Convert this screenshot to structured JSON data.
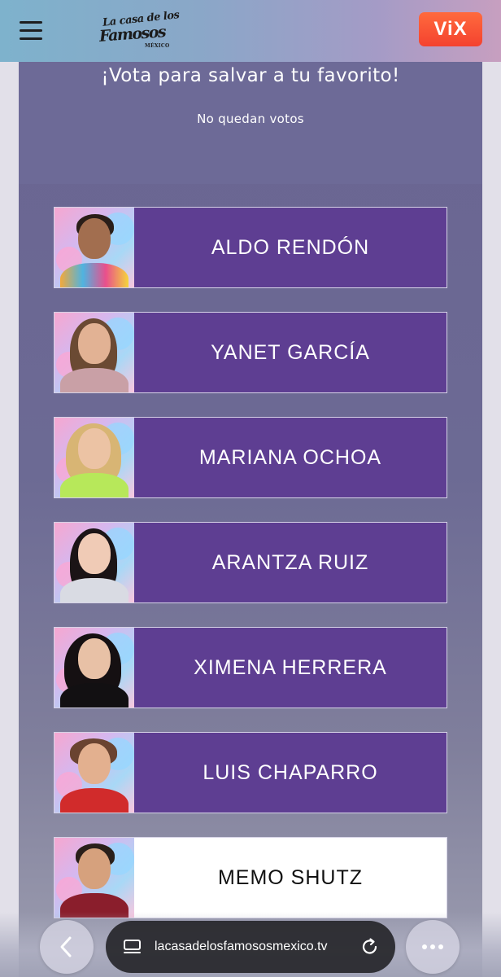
{
  "header": {
    "menu_icon": "hamburger-menu-icon",
    "logo": {
      "line1": "La casa de los",
      "line2": "Famosos",
      "line3": "MÉXICO"
    },
    "vix_label": "ViX",
    "vix_color": "#f4422f"
  },
  "vote": {
    "title": "¡Vota para salvar a tu favorito!",
    "status": "No quedan votos"
  },
  "contestants": [
    {
      "name": "ALDO RENDÓN",
      "selected": false
    },
    {
      "name": "YANET GARCÍA",
      "selected": false
    },
    {
      "name": "MARIANA OCHOA",
      "selected": false
    },
    {
      "name": "ARANTZA RUIZ",
      "selected": false
    },
    {
      "name": "XIMENA HERRERA",
      "selected": false
    },
    {
      "name": "LUIS CHAPARRO",
      "selected": false
    },
    {
      "name": "MEMO SHUTZ",
      "selected": true
    }
  ],
  "colors": {
    "card": "#5e3e92",
    "card_selected": "#ffffff",
    "panel": "#6d6a97"
  },
  "browser": {
    "back_icon": "chevron-left-icon",
    "tabs_icon": "tabs-icon",
    "url": "lacasadelosfamososmexico.tv",
    "reload_icon": "reload-icon",
    "more_icon": "more-dots-icon"
  }
}
